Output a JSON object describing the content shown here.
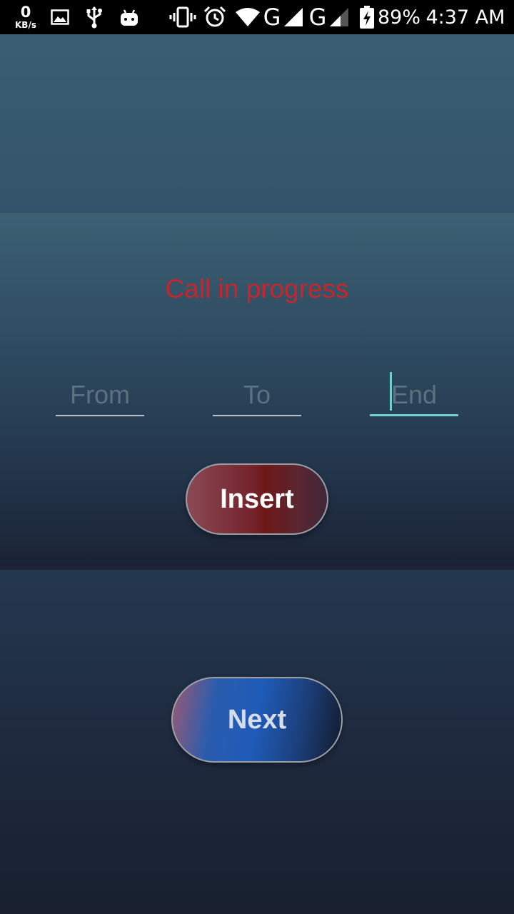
{
  "status_bar": {
    "net_speed_value": "0",
    "net_speed_unit": "KB/s",
    "battery": "89%",
    "time": "4:37 AM",
    "network_1": "G",
    "network_2": "G",
    "icons": [
      "image-icon",
      "usb-icon",
      "android-icon",
      "vibrate-icon",
      "alarm-icon",
      "wifi-icon",
      "signal-icon",
      "signal-icon",
      "battery-charging-icon"
    ]
  },
  "main": {
    "status_text": "Call in progress",
    "fields": {
      "from_placeholder": "From",
      "to_placeholder": "To",
      "end_placeholder": "End"
    },
    "insert_label": "Insert",
    "next_label": "Next"
  },
  "colors": {
    "status_text": "#c7252b",
    "active_underline": "#6fd0cf"
  }
}
